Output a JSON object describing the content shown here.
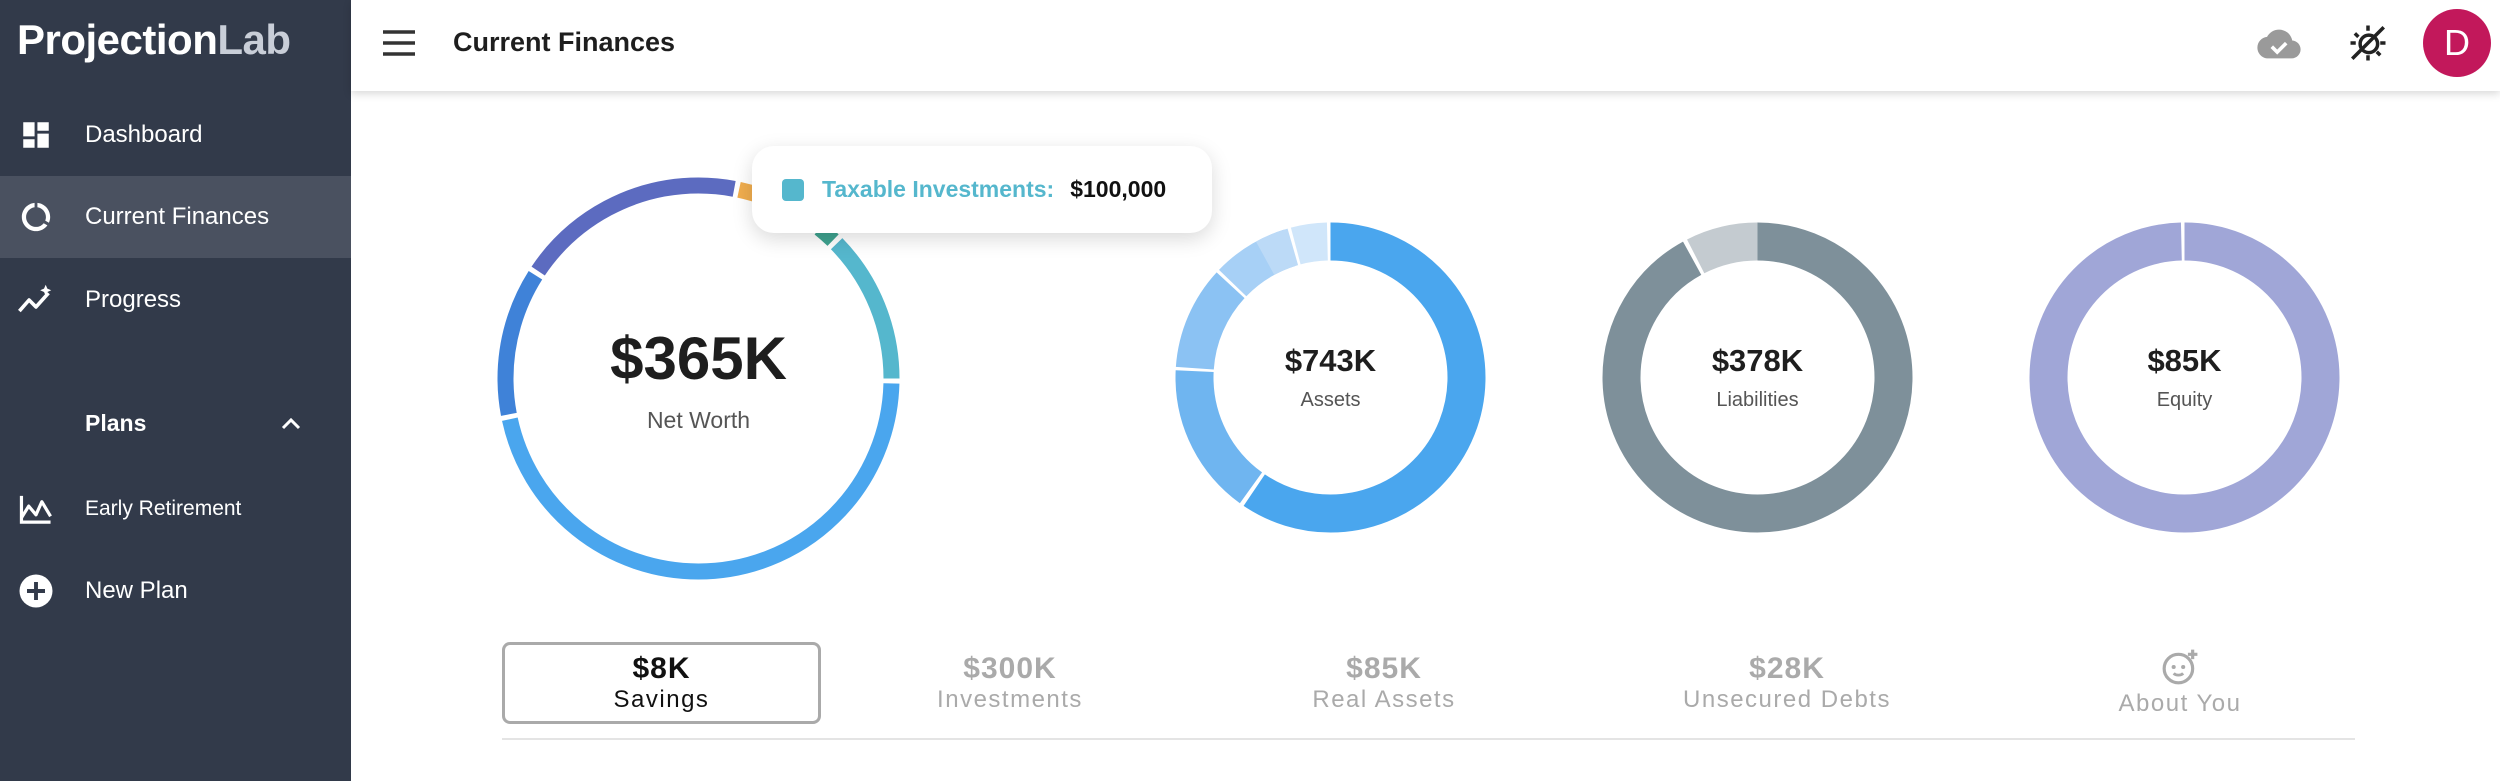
{
  "app": {
    "logo_main": "Projection",
    "logo_accent": "Lab"
  },
  "sidebar": {
    "items": [
      {
        "label": "Dashboard",
        "icon": "dashboard-icon"
      },
      {
        "label": "Current Finances",
        "icon": "donut-chart-icon",
        "active": true
      },
      {
        "label": "Progress",
        "icon": "trending-up-icon"
      }
    ],
    "plans_heading": "Plans",
    "plans": [
      {
        "label": "Early Retirement",
        "icon": "area-chart-icon"
      },
      {
        "label": "New Plan",
        "icon": "add-circle-icon"
      }
    ]
  },
  "header": {
    "title": "Current Finances",
    "avatar_initial": "D"
  },
  "net_worth": {
    "value": "$365K",
    "label": "Net Worth"
  },
  "tooltip": {
    "label": "Taxable Investments:",
    "value": "$100,000",
    "color": "#55b7cd"
  },
  "summary": [
    {
      "value": "$743K",
      "label": "Assets"
    },
    {
      "value": "$378K",
      "label": "Liabilities"
    },
    {
      "value": "$85K",
      "label": "Equity"
    }
  ],
  "tabs": [
    {
      "value": "$8K",
      "label": "Savings",
      "active": true
    },
    {
      "value": "$300K",
      "label": "Investments"
    },
    {
      "value": "$85K",
      "label": "Real Assets"
    },
    {
      "value": "$28K",
      "label": "Unsecured Debts"
    },
    {
      "value": "",
      "label": "About You",
      "icon": "face-plus-icon"
    }
  ],
  "colors": {
    "sidebar_bg": "#323a4a",
    "sidebar_active": "#4a5160",
    "avatar": "#c2185b",
    "assets_blue": "#4aa6ee",
    "liabilities_gray": "#7e909a",
    "equity_lavender": "#a0a6d7"
  }
}
